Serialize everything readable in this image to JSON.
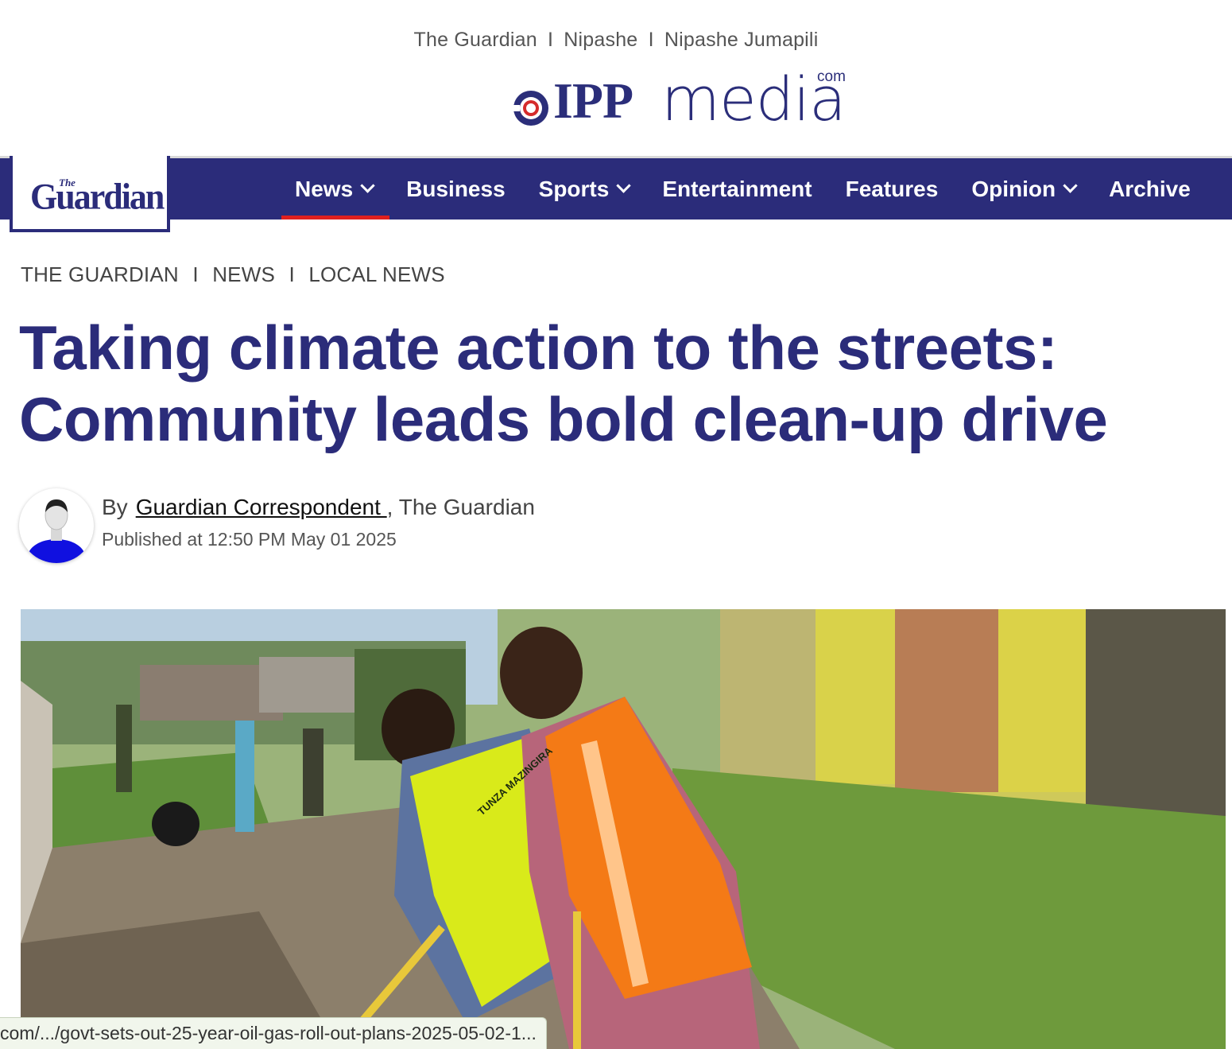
{
  "group_links": [
    "The Guardian",
    "Nipashe",
    "Nipashe Jumapili"
  ],
  "group_sep": "I",
  "ipp_logo": {
    "bold": "IPP",
    "light": "media",
    "suffix": "com"
  },
  "brand": {
    "the": "The",
    "name": "Guardian"
  },
  "nav": [
    {
      "label": "News",
      "dropdown": true,
      "active": true
    },
    {
      "label": "Business",
      "dropdown": false,
      "active": false
    },
    {
      "label": "Sports",
      "dropdown": true,
      "active": false
    },
    {
      "label": "Entertainment",
      "dropdown": false,
      "active": false
    },
    {
      "label": "Features",
      "dropdown": false,
      "active": false
    },
    {
      "label": "Opinion",
      "dropdown": true,
      "active": false
    },
    {
      "label": "Archive",
      "dropdown": false,
      "active": false
    }
  ],
  "breadcrumb": [
    "THE GUARDIAN",
    "NEWS",
    "LOCAL NEWS"
  ],
  "breadcrumb_sep": "I",
  "article": {
    "headline_line1": "Taking climate action to the streets:",
    "headline_line2": "Community leads bold clean-up drive",
    "by_label": "By",
    "author": "Guardian Correspondent ",
    "publication": ", The Guardian",
    "published": "Published at 12:50 PM May 01 2025"
  },
  "photo": {
    "vest_text": "TUNZA MAZINGIRA"
  },
  "status_url": "com/.../govt-sets-out-25-year-oil-gas-roll-out-plans-2025-05-02-1...",
  "colors": {
    "brand_navy": "#2b2c7a",
    "active_underline": "#e0201e"
  }
}
